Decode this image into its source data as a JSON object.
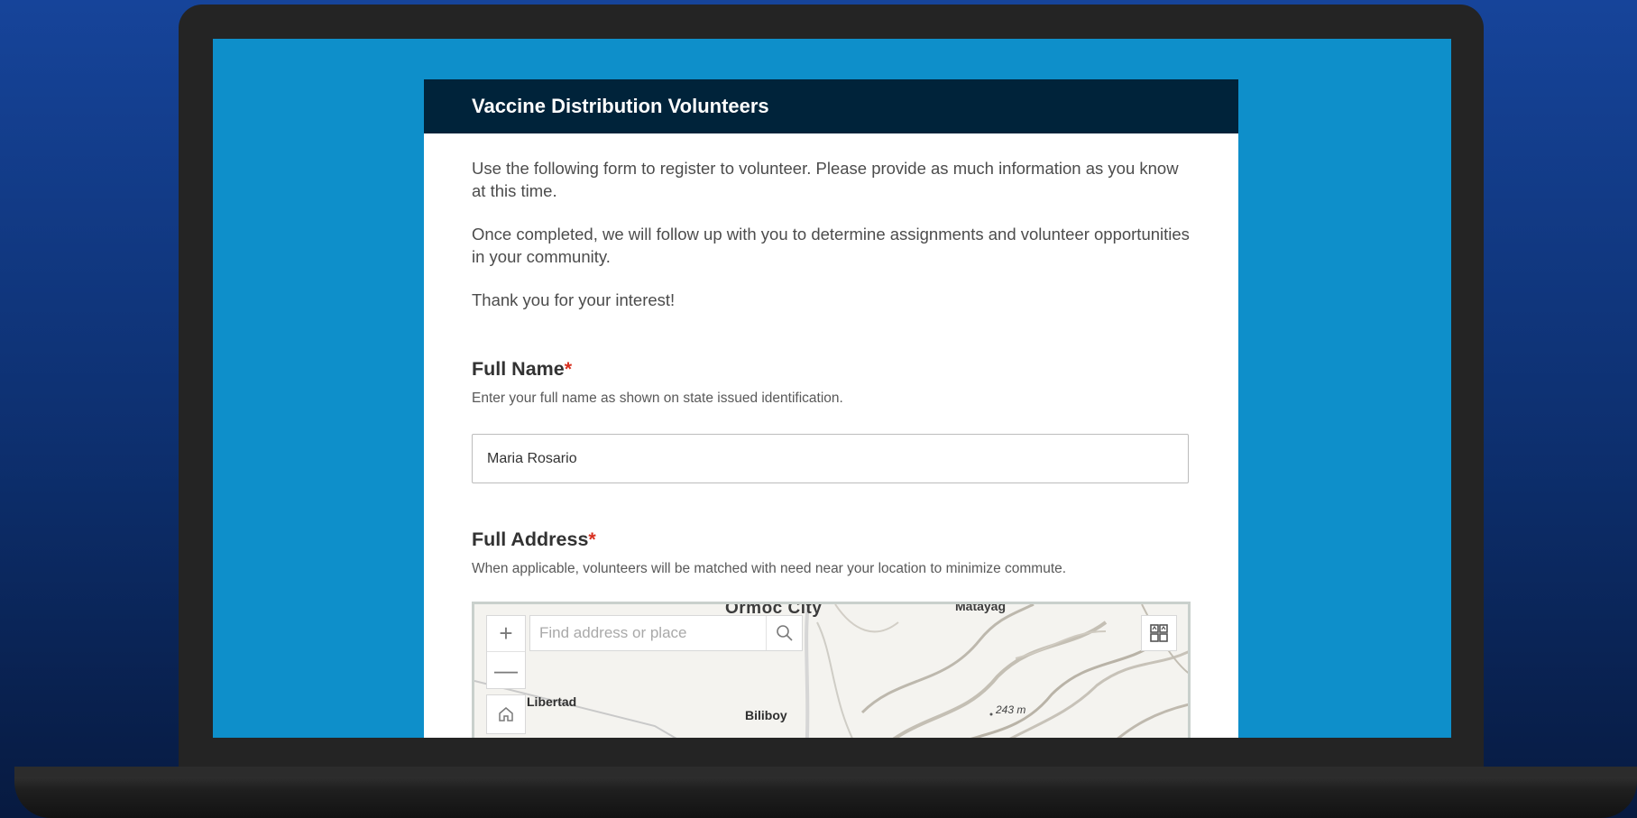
{
  "form": {
    "title": "Vaccine Distribution Volunteers",
    "intro": [
      "Use the following form to register to volunteer. Please provide as much information as you know at this time.",
      "Once completed, we will follow up with you to determine assignments and volunteer opportunities in your community.",
      "Thank you for your interest!"
    ],
    "required_marker": "*",
    "fields": {
      "full_name": {
        "label": "Full Name",
        "hint": "Enter your full name as shown on state issued identification.",
        "value": "Maria Rosario"
      },
      "full_address": {
        "label": "Full Address",
        "hint": "When applicable, volunteers will be matched with need near your location to minimize commute."
      }
    }
  },
  "map": {
    "search_placeholder": "Find address or place",
    "zoom_in": "+",
    "zoom_out": "—",
    "labels": {
      "ormoc": "Ormoc City",
      "matayag": "Matayag",
      "libertad": "Libertad",
      "biliboy": "Biliboy",
      "elevation": "243 m"
    }
  },
  "colors": {
    "header_bg": "#00233a",
    "screen_bg": "#0e8fca",
    "required": "#d83020"
  }
}
